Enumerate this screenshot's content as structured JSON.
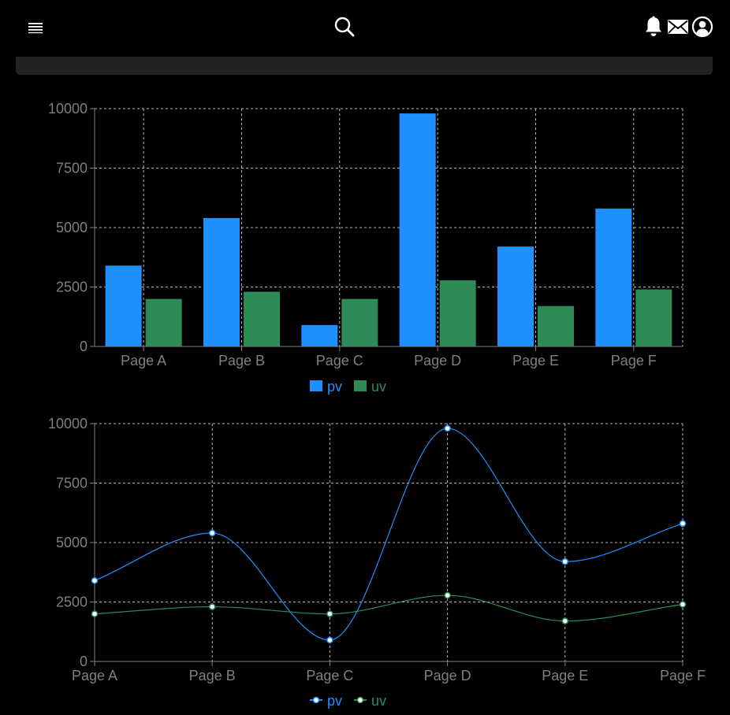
{
  "header": {
    "icons": [
      "menu-icon",
      "search-icon",
      "bell-icon",
      "mail-icon",
      "user-icon"
    ]
  },
  "colors": {
    "background": "#000000",
    "panel": "#232323",
    "pv": "#1e90ff",
    "uv": "#2e8b57",
    "grid": "#b8b8b8",
    "axis": "#7f7f7f"
  },
  "chart_data": [
    {
      "type": "bar",
      "categories": [
        "Page A",
        "Page B",
        "Page C",
        "Page D",
        "Page E",
        "Page F"
      ],
      "series": [
        {
          "name": "pv",
          "values": [
            3400,
            5400,
            900,
            9800,
            4200,
            5800
          ]
        },
        {
          "name": "uv",
          "values": [
            2000,
            2300,
            2000,
            2780,
            1700,
            2400
          ]
        }
      ],
      "yticks": [
        "0",
        "2500",
        "5000",
        "7500",
        "10000"
      ],
      "ylim": [
        0,
        10000
      ],
      "grid": true,
      "legend": "bottom-center"
    },
    {
      "type": "line",
      "categories": [
        "Page A",
        "Page B",
        "Page C",
        "Page D",
        "Page E",
        "Page F"
      ],
      "series": [
        {
          "name": "pv",
          "values": [
            3400,
            5400,
            900,
            9800,
            4200,
            5800
          ]
        },
        {
          "name": "uv",
          "values": [
            2000,
            2300,
            2000,
            2780,
            1700,
            2400
          ]
        }
      ],
      "yticks": [
        "0",
        "2500",
        "5000",
        "7500",
        "10000"
      ],
      "ylim": [
        0,
        10000
      ],
      "grid": true,
      "curve": "smooth",
      "legend": "bottom-center"
    }
  ]
}
